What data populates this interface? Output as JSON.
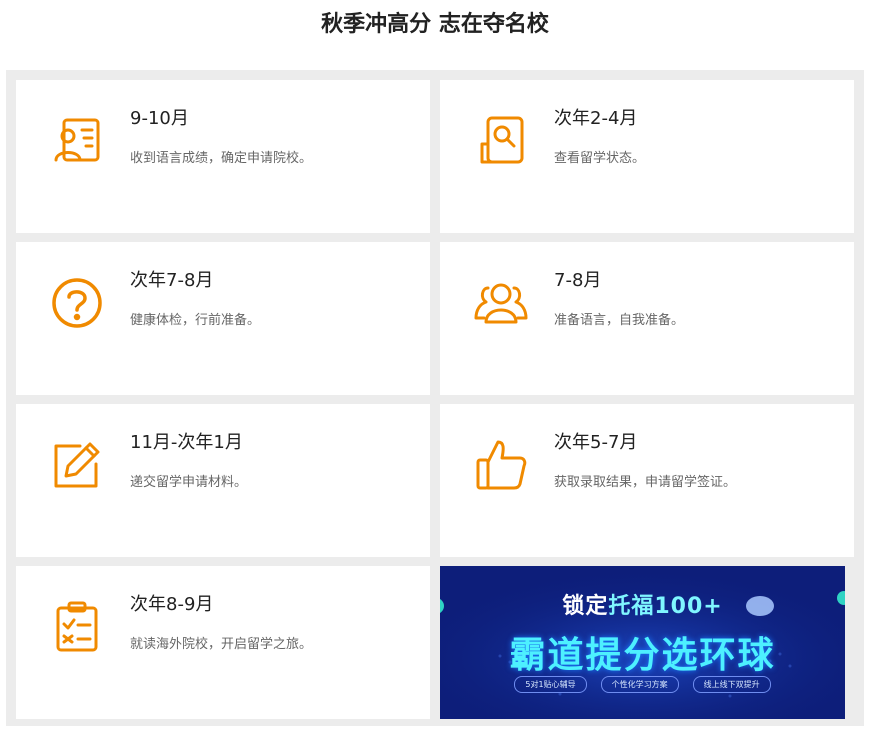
{
  "header": {
    "title": "秋季冲高分 志在夺名校"
  },
  "colors": {
    "accent": "#f08a00",
    "frame": "#ececec",
    "banner_bg": "#0d1e7a"
  },
  "timeline": [
    {
      "period": "9-10月",
      "desc": "收到语言成绩，确定申请院校。",
      "icon": "presenter-board-icon"
    },
    {
      "period": "次年2-4月",
      "desc": "查看留学状态。",
      "icon": "document-search-icon"
    },
    {
      "period": "次年7-8月",
      "desc": "健康体检，行前准备。",
      "icon": "question-circle-icon"
    },
    {
      "period": "7-8月",
      "desc": "准备语言，自我准备。",
      "icon": "user-group-icon"
    },
    {
      "period": "11月-次年1月",
      "desc": "递交留学申请材料。",
      "icon": "edit-pencil-icon"
    },
    {
      "period": "次年5-7月",
      "desc": "获取录取结果，申请留学签证。",
      "icon": "thumbs-up-icon"
    },
    {
      "period": "次年8-9月",
      "desc": "就读海外院校，开启留学之旅。",
      "icon": "clipboard-checklist-icon"
    }
  ],
  "banner": {
    "line1_prefix": "锁定",
    "line1_highlight": "托福100+",
    "line2": "霸道提分选环球",
    "pills": [
      "5对1贴心辅导",
      "个性化学习方案",
      "线上线下双提升"
    ]
  }
}
